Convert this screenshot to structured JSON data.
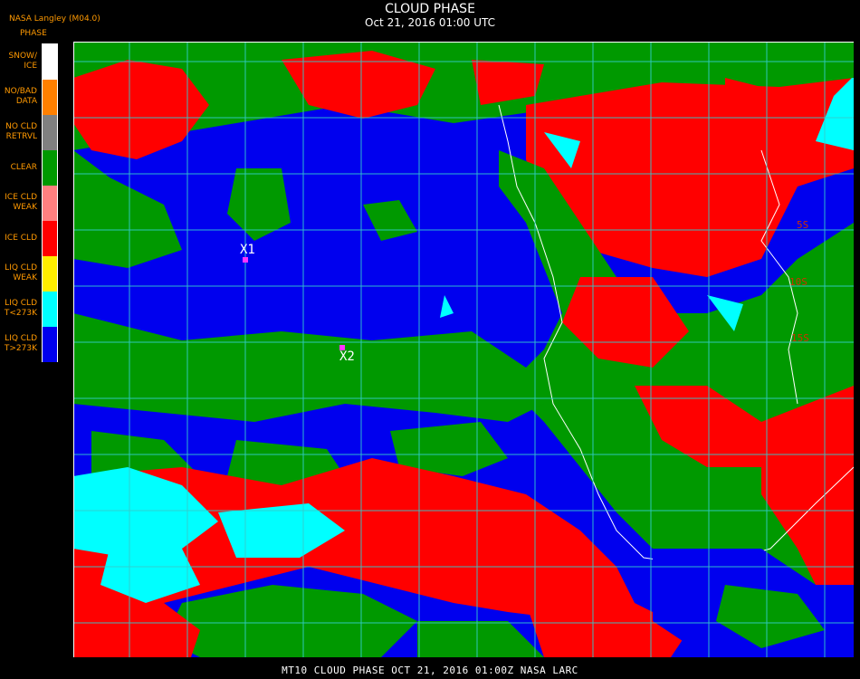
{
  "header": {
    "title": "CLOUD PHASE",
    "subtitle": "Oct 21, 2016 01:00 UTC",
    "source": "NASA Langley (M04.0)",
    "legend_caption": "PHASE"
  },
  "legend": [
    {
      "label": "SNOW/\nICE",
      "color": "#ffffff"
    },
    {
      "label": "NO/BAD\nDATA",
      "color": "#ff8000"
    },
    {
      "label": "NO CLD\nRETRVL",
      "color": "#808080"
    },
    {
      "label": "CLEAR",
      "color": "#009900"
    },
    {
      "label": "ICE CLD\nWEAK",
      "color": "#ff8080"
    },
    {
      "label": "ICE CLD",
      "color": "#ff0000"
    },
    {
      "label": "LIQ CLD\nWEAK",
      "color": "#ffee00"
    },
    {
      "label": "LIQ CLD\nT<273K",
      "color": "#00ffff"
    },
    {
      "label": "LIQ CLD\nT>273K",
      "color": "#0000ee"
    }
  ],
  "markers": [
    {
      "label": "X1",
      "color": "#ff33ff"
    },
    {
      "label": "X2",
      "color": "#ff33ff"
    }
  ],
  "lat_labels": [
    "5S",
    "10S",
    "15S"
  ],
  "footer": "MT10  CLOUD PHASE   OCT 21, 2016 01:00Z   NASA LARC",
  "colors": {
    "clear": "#009900",
    "ice": "#ff0000",
    "liquid_warm": "#0000ee",
    "liquid_cold": "#00ffff",
    "grid": "#33cccc",
    "coast": "#ffffff"
  }
}
